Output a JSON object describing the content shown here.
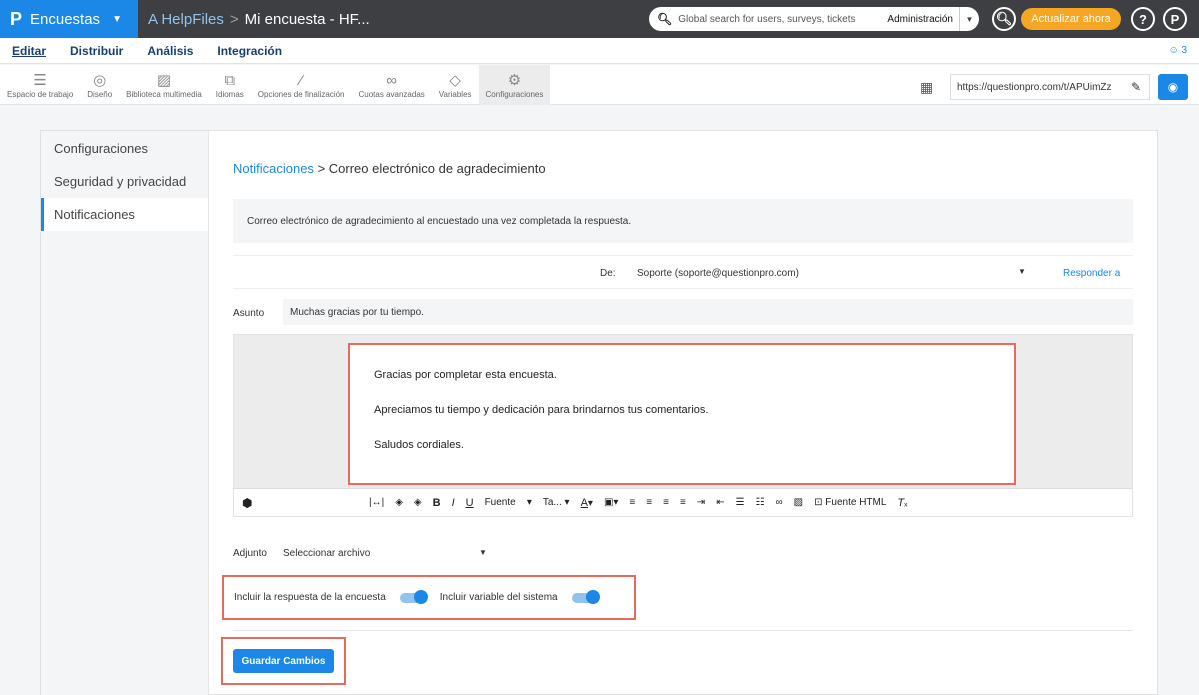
{
  "topbar": {
    "logo": "P",
    "app": "Encuestas",
    "crumb_root": "A HelpFiles",
    "crumb_current": "Mi encuesta - HF...",
    "search_placeholder": "Global search for users, surveys, tickets",
    "admin": "Administración",
    "upgrade": "Actualizar ahora",
    "help": "?",
    "profile": "P"
  },
  "nav2": {
    "items": [
      "Editar",
      "Distribuir",
      "Análisis",
      "Integración"
    ],
    "users_count": "3"
  },
  "toolbar": {
    "items": [
      "Espacio de trabajo",
      "Diseño",
      "Biblioteca multimedia",
      "Idiomas",
      "Opciones de finalización",
      "Cuotas avanzadas",
      "Variables",
      "Configuraciones"
    ],
    "url": "https://questionpro.com/t/APUimZz"
  },
  "sidebar": {
    "items": [
      "Configuraciones",
      "Seguridad y privacidad",
      "Notificaciones"
    ]
  },
  "main": {
    "crumb_link": "Notificaciones",
    "crumb_current": "Correo electrónico de agradecimiento",
    "description": "Correo electrónico de agradecimiento al encuestado una vez completada la respuesta.",
    "from_label": "De:",
    "from_value": "Soporte (soporte@questionpro.com)",
    "reply_to": "Responder a",
    "subject_label": "Asunto",
    "subject_value": "Muchas gracias por tu tiempo.",
    "body": [
      "Gracias por completar esta encuesta.",
      "Apreciamos tu tiempo y dedicación para brindarnos tus comentarios.",
      "Saludos cordiales."
    ],
    "editor": {
      "font_label": "Fuente",
      "size_label": "Ta...",
      "html_label": "Fuente HTML"
    },
    "attach_label": "Adjunto",
    "attach_value": "Seleccionar archivo",
    "toggle1": "Incluir la respuesta de la encuesta",
    "toggle2": "Incluir variable del sistema",
    "toggle1_on": true,
    "toggle2_on": true,
    "save": "Guardar Cambios"
  }
}
